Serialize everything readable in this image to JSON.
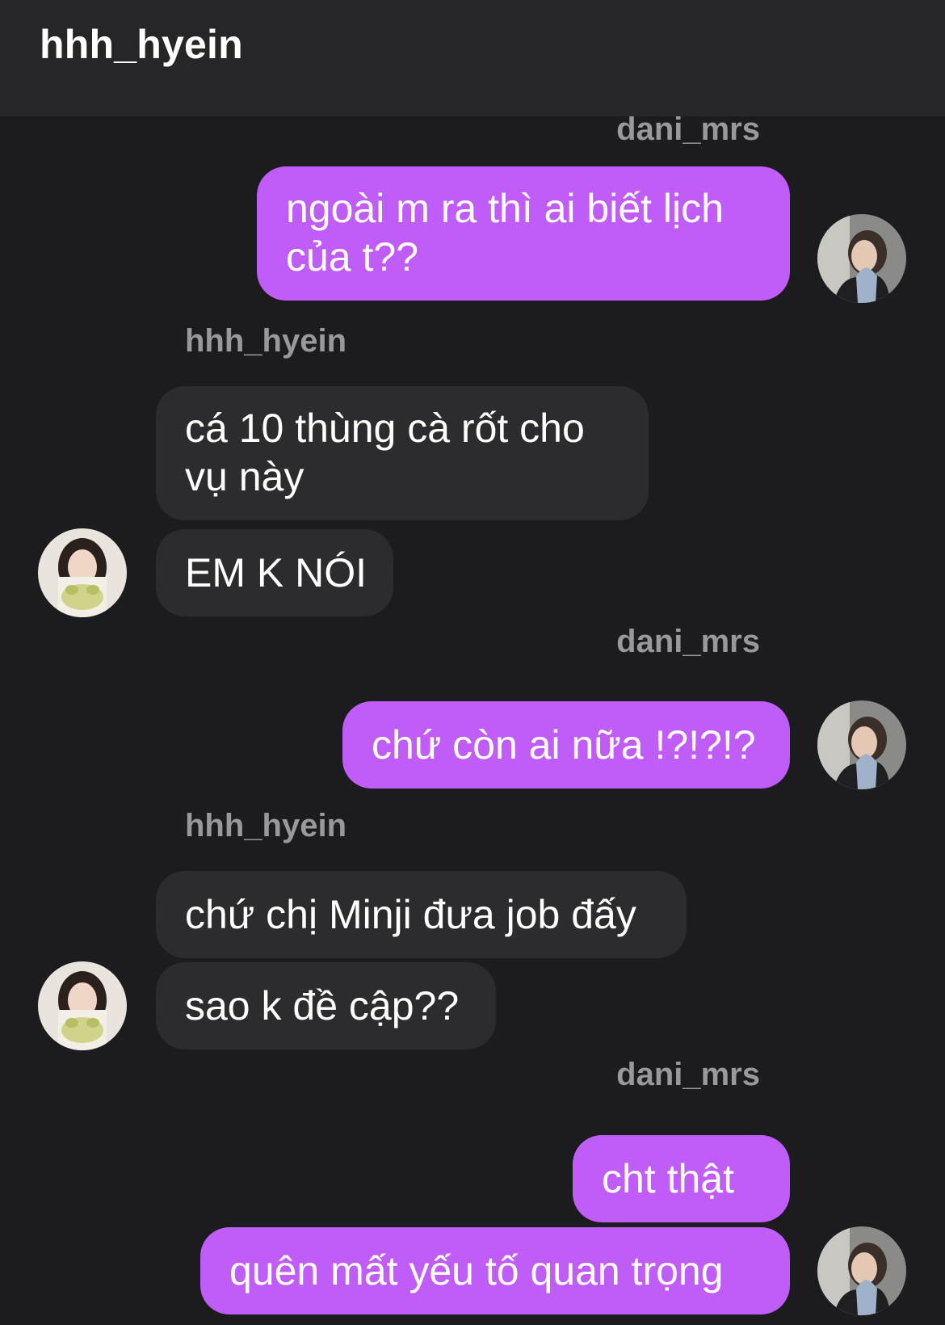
{
  "header": {
    "title": "hhh_hyein"
  },
  "users": {
    "me": "dani_mrs",
    "other": "hhh_hyein"
  },
  "messages": [
    {
      "from": "dani_mrs",
      "text_line1": "ngoài m ra thì ai biết lịch",
      "text_line2": "của t??"
    },
    {
      "from": "hhh_hyein",
      "text_line1": "cá 10 thùng cà rốt cho",
      "text_line2": "vụ này"
    },
    {
      "from": "hhh_hyein",
      "text": "EM K NÓI"
    },
    {
      "from": "dani_mrs",
      "text": "chứ còn ai nữa !?!?!?"
    },
    {
      "from": "hhh_hyein",
      "text": "chứ chị Minji đưa job đấy"
    },
    {
      "from": "hhh_hyein",
      "text": "sao k đề cập??"
    },
    {
      "from": "dani_mrs",
      "text": "cht thật"
    },
    {
      "from": "dani_mrs",
      "text": "quên mất yếu tố quan trọng"
    }
  ],
  "colors": {
    "background": "#1c1c1e",
    "header": "#262628",
    "outgoing_bubble": "#c05cf7",
    "incoming_bubble": "#2c2c2e",
    "sender_label": "#98989d"
  },
  "icons": {
    "dani_avatar": "avatar-photo",
    "hyein_avatar": "avatar-photo"
  }
}
